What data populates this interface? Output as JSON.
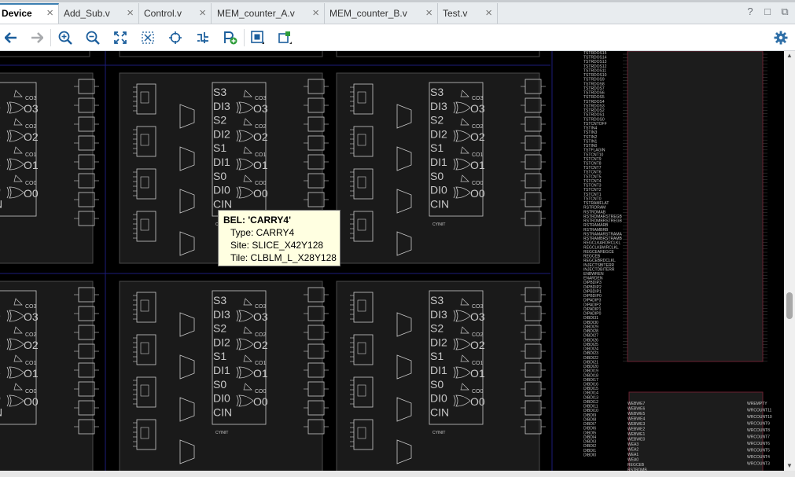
{
  "tabs": [
    {
      "label": "Device",
      "active": true
    },
    {
      "label": "Add_Sub.v",
      "active": false
    },
    {
      "label": "Control.v",
      "active": false
    },
    {
      "label": "MEM_counter_A.v",
      "active": false
    },
    {
      "label": "MEM_counter_B.v",
      "active": false
    },
    {
      "label": "Test.v",
      "active": false
    }
  ],
  "tab_close_glyph": "×",
  "tabbar_icons": [
    {
      "name": "help-icon",
      "glyph": "?"
    },
    {
      "name": "restore-window-icon",
      "glyph": "□"
    },
    {
      "name": "float-window-icon",
      "glyph": "⧉"
    }
  ],
  "toolbar": [
    {
      "name": "back-icon"
    },
    {
      "name": "forward-icon"
    },
    {
      "name": "zoom-in-icon"
    },
    {
      "name": "zoom-out-icon"
    },
    {
      "name": "zoom-fit-icon"
    },
    {
      "name": "zoom-selection-icon"
    },
    {
      "name": "autofit-selection-icon"
    },
    {
      "name": "routing-resources-icon"
    },
    {
      "name": "add-pblock-icon"
    },
    {
      "name": "show-bels-icon"
    },
    {
      "name": "route-nodes-icon"
    },
    {
      "name": "settings-gear-icon"
    }
  ],
  "canvas": {
    "slice_port_labels": [
      "S3",
      "DI3",
      "S2",
      "DI2",
      "S1",
      "DI1",
      "S0",
      "DI0",
      "CIN"
    ],
    "carry_output_labels": [
      "CO3",
      "O3",
      "CO2",
      "O2",
      "CO1",
      "O1",
      "CO0",
      "O0"
    ],
    "cyinit_label": "CYINIT",
    "pin_labels_upper": [
      "TSTRDOS15",
      "TSTRDOS14",
      "TSTRDOS13",
      "TSTRDOS12",
      "TSTRDOS11",
      "TSTRDOS10",
      "TSTRDOS9",
      "TSTRDOS8",
      "TSTRDOS7",
      "TSTRDOS6",
      "TSTRDOS5",
      "TSTRDOS4",
      "TSTRDOS3",
      "TSTRDOS2",
      "TSTRDOS1",
      "TSTRDOS0",
      "TSTCNTOFF",
      "TSTIN4",
      "TSTIN3",
      "TSTIN2",
      "TSTIN1",
      "TSTIN0",
      "TSTFLAGIN",
      "TSTCNT10",
      "TSTCNT9",
      "TSTCNT8",
      "TSTCNT7",
      "TSTCNT6",
      "TSTCNT5",
      "TSTCNT4",
      "TSTCNT3",
      "TSTCNT2",
      "TSTCNT1",
      "TSTCNT0",
      "TSTRAMFLAT",
      "RSTRDRAM",
      "RSTRDMAB",
      "RSTRDMARSTREGB",
      "RSTRDMBRSTREGB",
      "RSTRAMARB",
      "RSTRAMBRB",
      "RSTRAMARSTRAMA",
      "RSTRAMBRSTRAMB",
      "REGCLKARDRCLKL",
      "REGCLKBWRCLKL",
      "REGCEAREGCE",
      "REGCEB",
      "REGCEBRDCLKL",
      "INJECTSBITERR",
      "INJECTDBITERR",
      "ENBWREN",
      "ENARDEN",
      "DIPBDIP3",
      "DIPBDIP2",
      "DIPBDIP1",
      "DIPBDIP0",
      "DIPADIP3",
      "DIPADIP2",
      "DIPADIP1",
      "DIPADIP0",
      "DIBDI31",
      "DIBDI30",
      "DIBDI29",
      "DIBDI28",
      "DIBDI27",
      "DIBDI26",
      "DIBDI25",
      "DIBDI24",
      "DIBDI23",
      "DIBDI22",
      "DIBDI21",
      "DIBDI20",
      "DIBDI19",
      "DIBDI18",
      "DIBDI17",
      "DIBDI16",
      "DIBDI15",
      "DIBDI14",
      "DIBDI13",
      "DIBDI12",
      "DIBDI11",
      "DIBDI10",
      "DIBDI9",
      "DIBDI8",
      "DIBDI7",
      "DIBDI6",
      "DIBDI5",
      "DIBDI4",
      "DIBDI3",
      "DIBDI2",
      "DIBDI1",
      "DIBDI0"
    ],
    "pin_labels_lower_left": [
      "WEBWE7",
      "WEBWE6",
      "WEBWE5",
      "WEBWE4",
      "WEBWE3",
      "WEBWE2",
      "WEBWE1",
      "WEBWE0",
      "WEA3",
      "WEA2",
      "WEA1",
      "WEA0",
      "REGCEB",
      "RSTRDMB"
    ],
    "pin_labels_lower_right": [
      "WREMPTY",
      "WRCOUNT11",
      "WRCOUNT10",
      "WRCOUNT9",
      "WRCOUNT8",
      "WRCOUNT7",
      "WRCOUNT6",
      "WRCOUNT5",
      "WRCOUNT4",
      "WRCOUNT3"
    ]
  },
  "tooltip": {
    "title": "BEL: 'CARRY4'",
    "type": "Type: CARRY4",
    "site": "Site: SLICE_X42Y128",
    "tile": "Tile: CLBLM_L_X28Y128"
  },
  "colors": {
    "tile_border": "#4a4a4a",
    "element_stroke": "#c8c8c8",
    "clock_line": "#1c1c7a",
    "bram_border": "#6a2030",
    "active_tab_accent": "#3c7fb1",
    "gear": "#2f6fa7"
  }
}
